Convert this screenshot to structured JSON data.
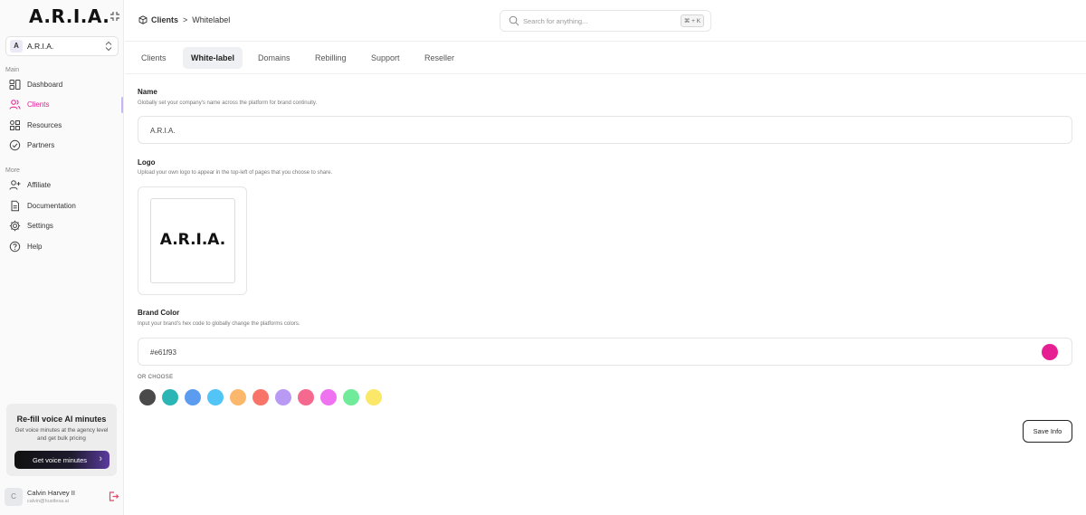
{
  "app": {
    "logo": "A.R.I.A."
  },
  "workspace": {
    "initial": "A",
    "name": "A.R.I.A."
  },
  "sidebar": {
    "main_label": "Main",
    "more_label": "More",
    "main_items": [
      {
        "label": "Dashboard",
        "icon": "dashboard-icon"
      },
      {
        "label": "Clients",
        "icon": "users-icon",
        "active": true
      },
      {
        "label": "Resources",
        "icon": "grid-icon"
      },
      {
        "label": "Partners",
        "icon": "check-circle-icon"
      }
    ],
    "more_items": [
      {
        "label": "Affiliate",
        "icon": "user-plus-icon"
      },
      {
        "label": "Documentation",
        "icon": "document-icon"
      },
      {
        "label": "Settings",
        "icon": "gear-icon"
      },
      {
        "label": "Help",
        "icon": "help-icon"
      }
    ]
  },
  "promo": {
    "title": "Re-fill voice AI minutes",
    "text": "Get voice minutes at the agency level and get bulk pricing",
    "button": "Get voice minutes",
    "arrow": "›"
  },
  "user": {
    "initial": "C",
    "name": "Calvin Harvey II",
    "email": "calvin@hustlesa.ai"
  },
  "breadcrumb": {
    "parent": "Clients",
    "separator": ">",
    "current": "Whitelabel"
  },
  "search": {
    "placeholder": "Search for anything...",
    "shortcut": "⌘ + K"
  },
  "tabs": [
    {
      "label": "Clients"
    },
    {
      "label": "White-label",
      "active": true
    },
    {
      "label": "Domains"
    },
    {
      "label": "Rebilling"
    },
    {
      "label": "Support"
    },
    {
      "label": "Reseller"
    }
  ],
  "form": {
    "name": {
      "label": "Name",
      "hint": "Globally set your company's name across the platform for brand continuity.",
      "value": "A.R.I.A."
    },
    "logo": {
      "label": "Logo",
      "hint": "Upload your own logo to appear in the top-left of pages that you choose to share.",
      "preview_text": "A.R.I.A."
    },
    "brand_color": {
      "label": "Brand Color",
      "hint": "Input your brand's hex code to globally change the platforms colors.",
      "value": "#e61f93",
      "or_choose": "OR CHOOSE",
      "swatches": [
        "#4a4a4a",
        "#2bb5b5",
        "#5b9cf0",
        "#52c4f5",
        "#fbb86c",
        "#f87469",
        "#b89af4",
        "#f5698f",
        "#ef72f0",
        "#70eb9a",
        "#fbe768"
      ]
    },
    "save_label": "Save Info"
  }
}
